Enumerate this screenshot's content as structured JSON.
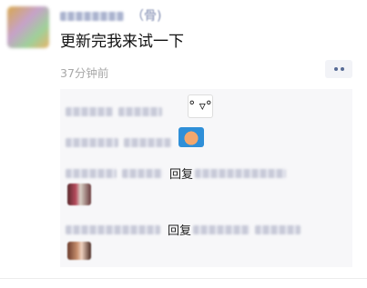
{
  "post": {
    "author_name": "",
    "author_suffix": "（骨)",
    "text": "更新完我来试一下",
    "time": "37分钟前"
  },
  "comments": {
    "reply_word": "回复"
  },
  "icons": {
    "more": "more-dots-icon"
  },
  "colors": {
    "name_link": "#576b95",
    "time": "#a8a8a8",
    "comment_bg": "#f7f7f9"
  }
}
